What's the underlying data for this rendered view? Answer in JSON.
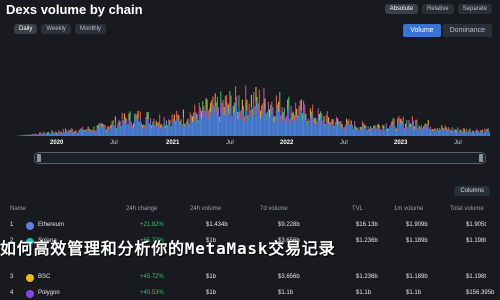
{
  "header": {
    "title": "Dexs volume by chain",
    "toggles": [
      "Absolute",
      "Relative",
      "Separate"
    ]
  },
  "range_tabs": [
    "Daily",
    "Weekly",
    "Monthly"
  ],
  "volume_tabs": [
    "Volume",
    "Dominance"
  ],
  "chart": {
    "x_ticks": [
      "2020",
      "Jul",
      "2021",
      "Jul",
      "2022",
      "Jul",
      "2023",
      "Jul"
    ]
  },
  "table": {
    "columns_button": "Columns",
    "headers": [
      "Name",
      "24h change",
      "24h volume",
      "7d volume",
      "TVL",
      "1m volume",
      "Total volume"
    ],
    "rows": [
      {
        "rank": "1",
        "name": "Ethereum",
        "change": "+21.82%",
        "vol24": "$1.434b",
        "vol7d": "$9.228b",
        "tvl": "$16.13b",
        "vol1m": "$1.909b",
        "total": "$1.905t",
        "icon_color": "#627eea"
      },
      {
        "rank": "2",
        "name": "Solana",
        "change": "+65.72%",
        "vol24": "$1b",
        "vol7d": "$3.656b",
        "tvl": "$1.236b",
        "vol1m": "$1.189b",
        "total": "$1.198t",
        "icon_color": "#14c3b5"
      },
      {
        "rank": "3",
        "name": "BSC",
        "change": "+45.72%",
        "vol24": "$1b",
        "vol7d": "$3.656b",
        "tvl": "$1.236b",
        "vol1m": "$1.189b",
        "total": "$1.198t",
        "icon_color": "#f0b90b"
      },
      {
        "rank": "4",
        "name": "Polygon",
        "change": "+40.53%",
        "vol24": "$1b",
        "vol7d": "$1.1b",
        "tvl": "$1.1b",
        "vol1m": "$1.1b",
        "total": "$156.395b",
        "icon_color": "#8247e5"
      }
    ]
  },
  "overlay_text": "如何高效管理和分析你的MetaMask交易记录"
}
